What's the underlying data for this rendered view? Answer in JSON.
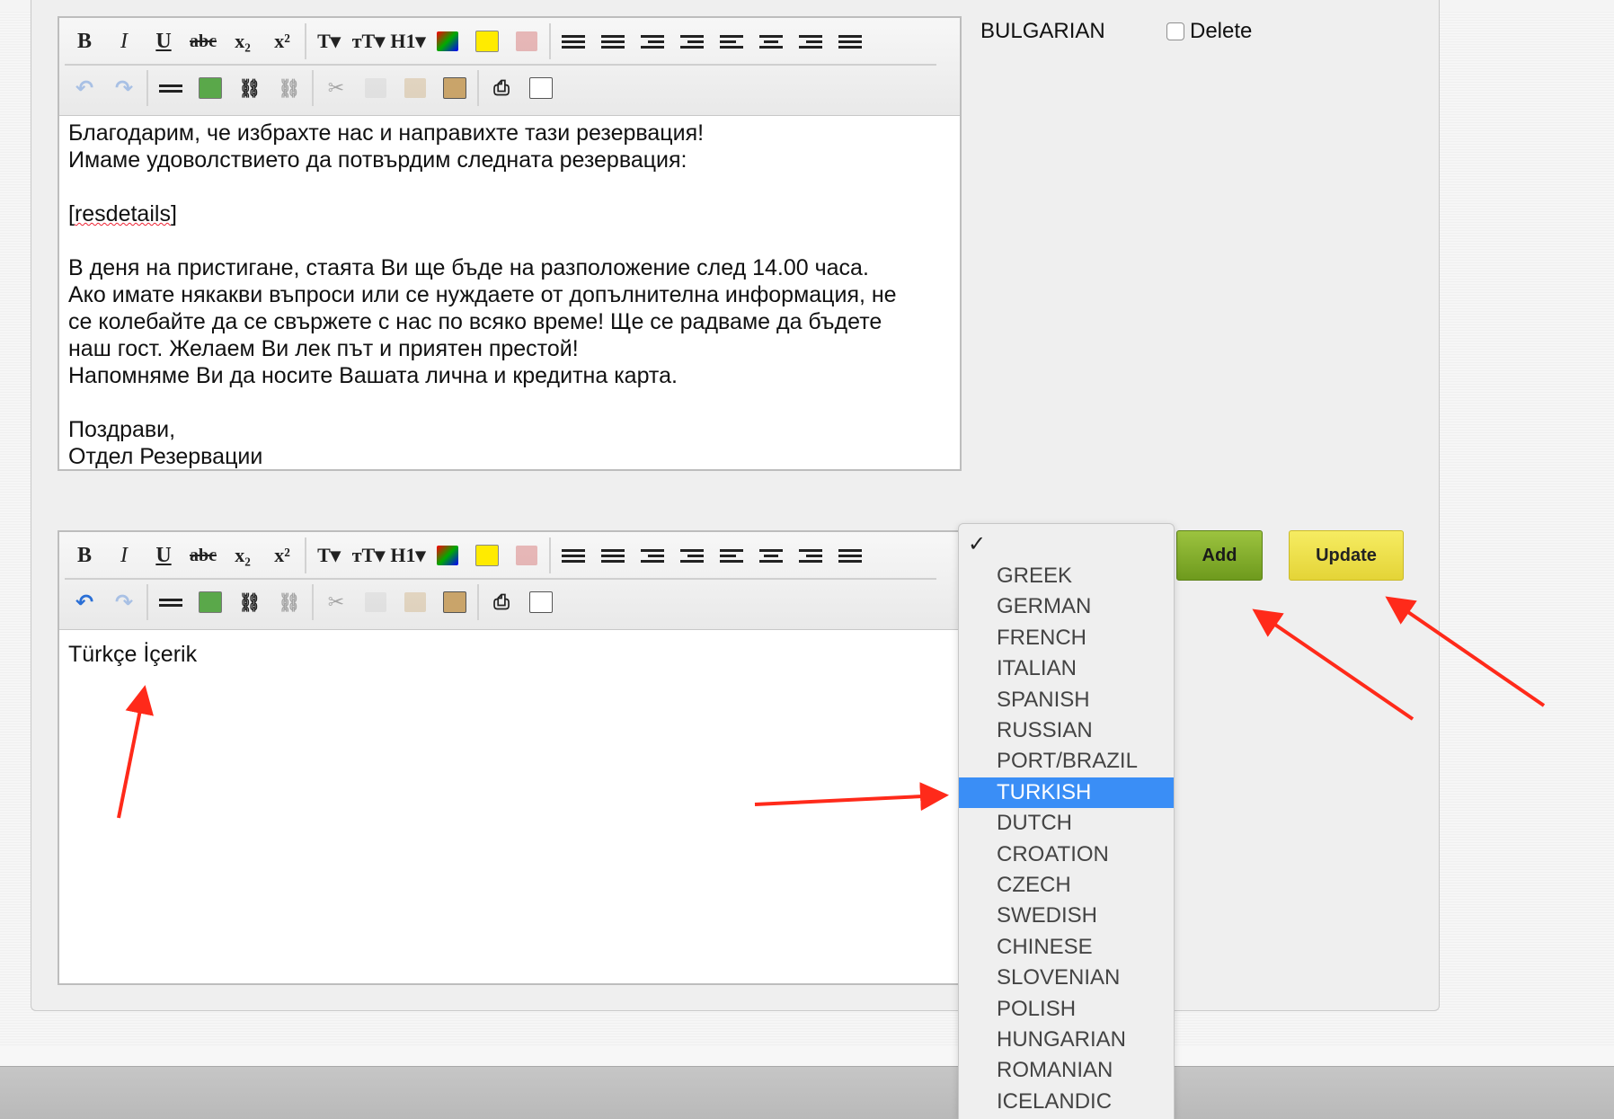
{
  "language_row": {
    "language_label": "BULGARIAN",
    "delete_label": "Delete",
    "delete_checked": false
  },
  "editor_top": {
    "lines": [
      "Благодарим, че избрахте нас и направихте тази резервация!",
      "Имаме удоволствието да потвърдим следната резервация:",
      "",
      "[resdetails]",
      "",
      "В деня на пристигане, стаята Ви ще бъде на разположение след 14.00 часа.",
      "Ако имате някакви въпроси или се нуждаете от допълнителна информация, не",
      "се колебайте да се свържете с нас по всяко време! Ще се радваме да бъдете",
      "наш гост. Желаем Ви лек път и приятен престой!",
      "Напомняме Ви да носите Вашата лична и кредитна карта.",
      "",
      "Поздрави,",
      "Отдел Резервации"
    ]
  },
  "editor_bottom": {
    "content": "Türkçe İçerik"
  },
  "toolbar": {
    "bold": "B",
    "italic": "I",
    "underline": "U",
    "strike": "abc",
    "subscript": "x₂",
    "superscript": "x²",
    "font": "T▾",
    "font_size": "тT▾",
    "heading": "H1▾"
  },
  "language_dropdown": {
    "current": "",
    "selected": "TURKISH",
    "options": [
      "GREEK",
      "GERMAN",
      "FRENCH",
      "ITALIAN",
      "SPANISH",
      "RUSSIAN",
      "PORT/BRAZIL",
      "TURKISH",
      "DUTCH",
      "CROATION",
      "CZECH",
      "SWEDISH",
      "CHINESE",
      "SLOVENIAN",
      "POLISH",
      "HUNGARIAN",
      "ROMANIAN",
      "ICELANDIC"
    ]
  },
  "buttons": {
    "add": "Add",
    "update": "Update"
  },
  "colors": {
    "add_green": "#7ba628",
    "update_yellow": "#ecdf45",
    "selection_blue": "#3a8ef6",
    "annotation_red": "#ff2a1a"
  }
}
